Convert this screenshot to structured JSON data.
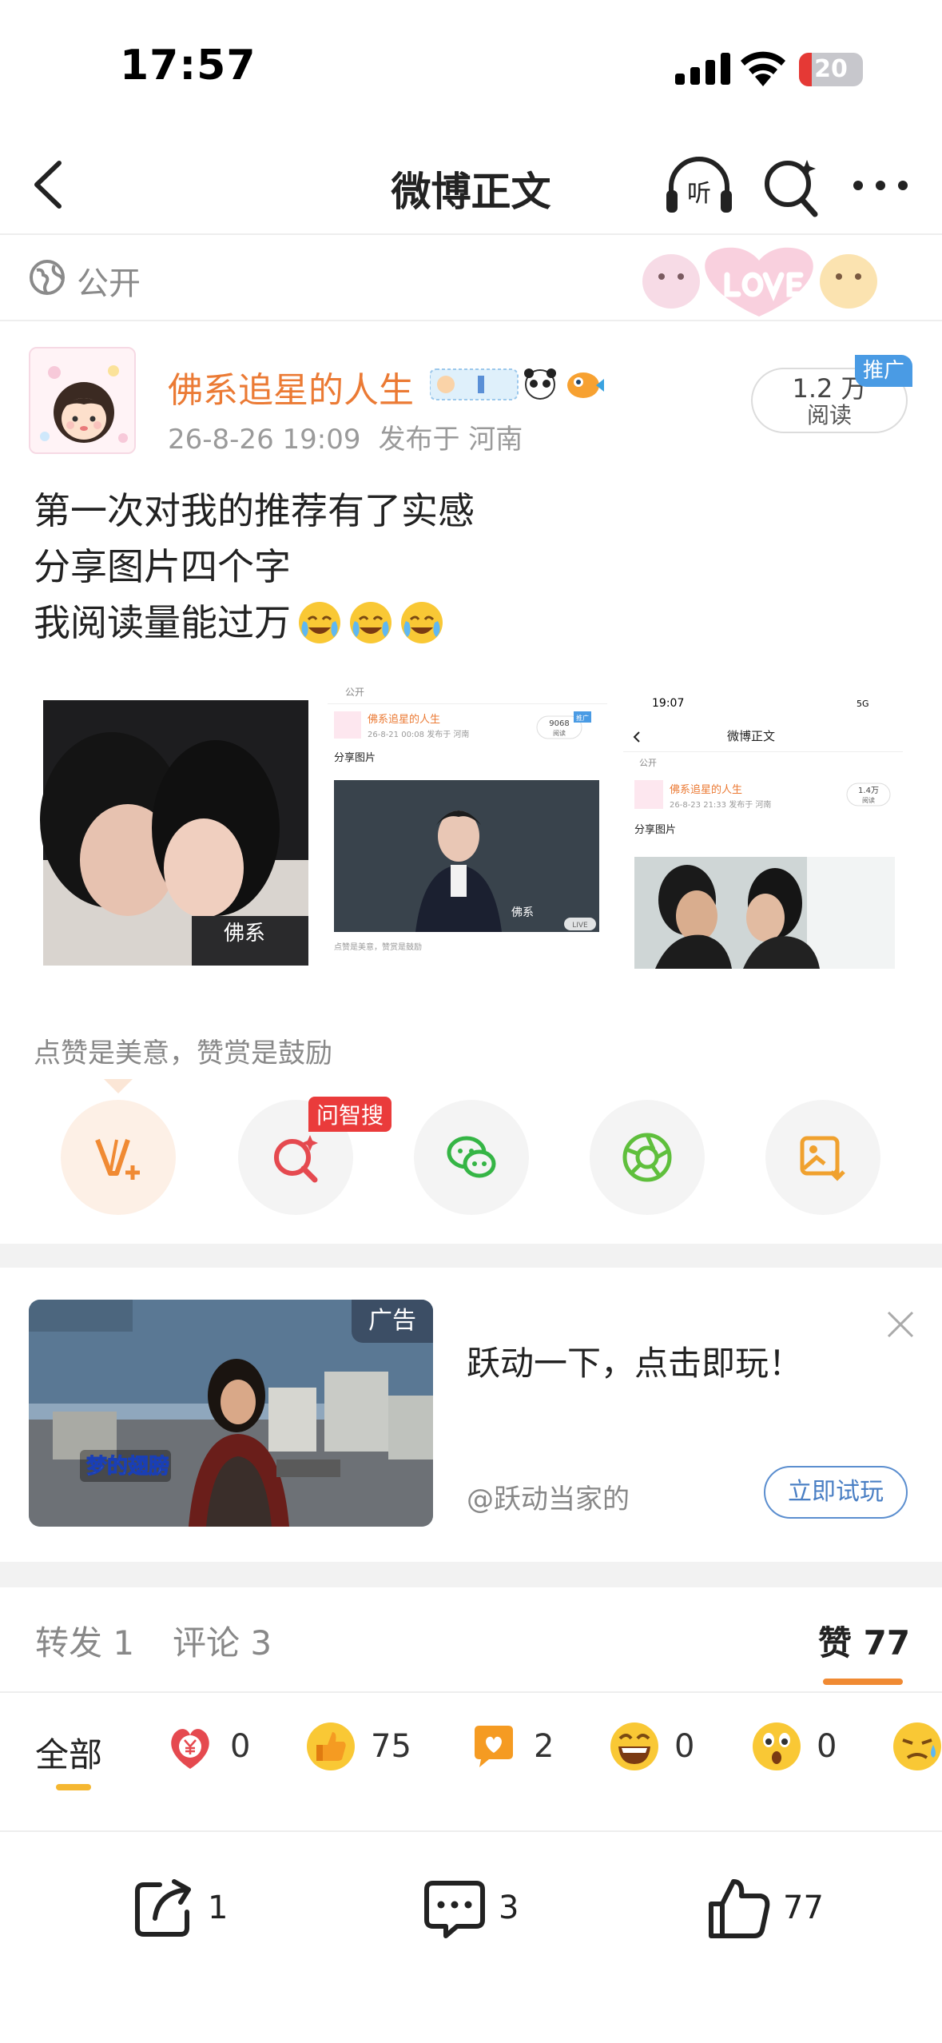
{
  "status_bar": {
    "time": "17:57",
    "battery": "20",
    "battery_level": 0.2
  },
  "nav": {
    "title": "微博正文",
    "listen_icon_text": "听"
  },
  "visibility": {
    "label": "公开"
  },
  "author": {
    "name": "佛系追星的人生",
    "date": "26-8-26 19:09",
    "location": "发布于 河南"
  },
  "read_pill": {
    "count": "1.2 万",
    "label": "阅读",
    "tag": "推广"
  },
  "post": {
    "lines": [
      "第一次对我的推荐有了实感",
      "分享图片四个字",
      "我阅读量能过万"
    ]
  },
  "images": {
    "img1_watermark": "佛系",
    "img2": {
      "header": "公开",
      "name": "佛系追星的人生",
      "meta": "26-8-21 00:08  发布于 河南",
      "reads": "9068",
      "reads_label": "阅读",
      "tag": "推广",
      "text": "分享图片",
      "footer": "点赞是美意，赞赏是鼓励",
      "live": "LIVE",
      "watermark": "佛系"
    },
    "img3": {
      "time": "19:07",
      "net": "5G",
      "title": "微博正文",
      "header": "公开",
      "name": "佛系追星的人生",
      "meta": "26-8-23 21:33  发布于 河南",
      "reads": "1.4万",
      "reads_label": "阅读",
      "text": "分享图片"
    }
  },
  "reward": {
    "text": "点赞是美意，赞赏是鼓励",
    "ai_tag": "问智搜"
  },
  "ad": {
    "label": "广告",
    "title": "跃动一下，点击即玩！",
    "account": "@跃动当家的",
    "cta": "立即试玩",
    "image_caption": "梦的翅膀"
  },
  "tabs": {
    "repost": "转发 1",
    "comment": "评论 3",
    "like": "赞 77"
  },
  "reactions": {
    "all": "全部",
    "items": [
      {
        "icon": "reward-yuan-icon",
        "count": "0"
      },
      {
        "icon": "thumbs-up-icon",
        "count": "75"
      },
      {
        "icon": "heart-bubble-icon",
        "count": "2"
      },
      {
        "icon": "laughing-icon",
        "count": "0"
      },
      {
        "icon": "surprised-icon",
        "count": "0"
      }
    ]
  },
  "bottom_bar": {
    "repost": "1",
    "comment": "3",
    "like": "77"
  },
  "colors": {
    "accent": "#eb7a34",
    "link_blue": "#4a7fc4",
    "promo_blue": "#4a9be4",
    "tab_underline": "#f08a33"
  }
}
